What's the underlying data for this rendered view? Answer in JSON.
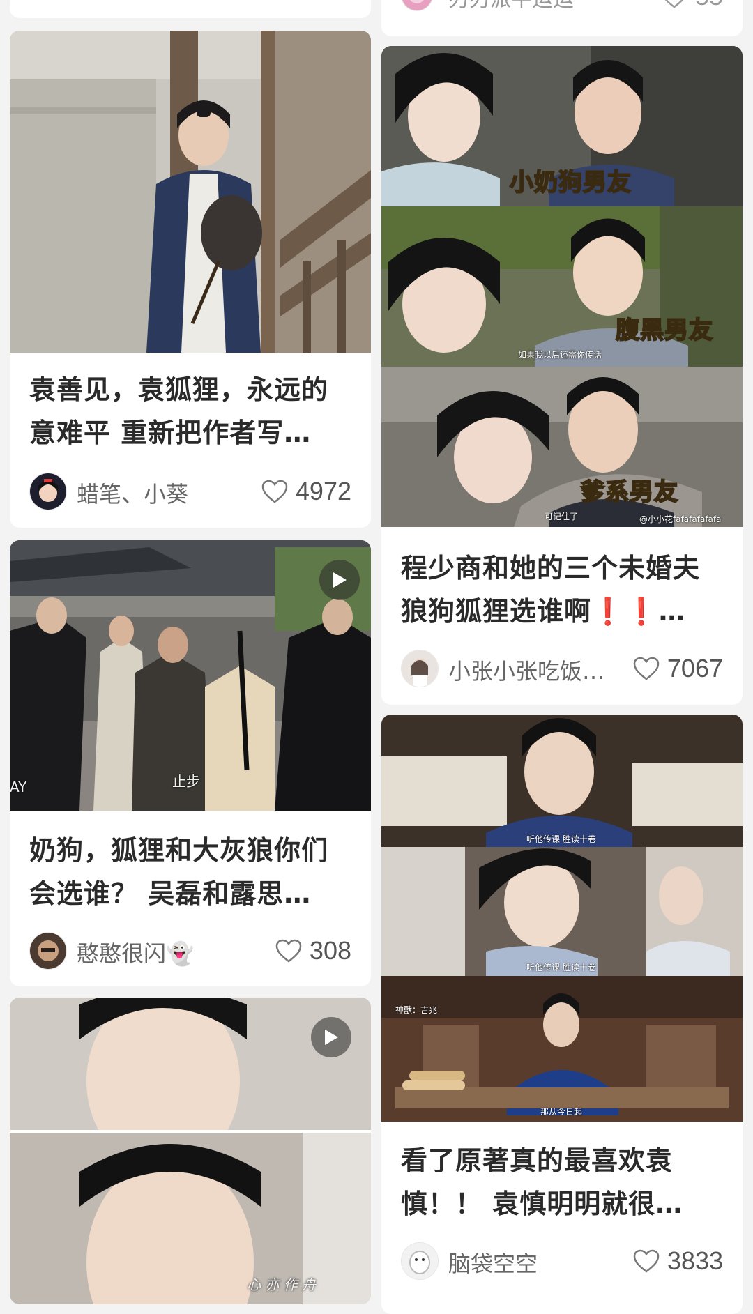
{
  "colors": {
    "background": "#f3f3f3",
    "card": "#ffffff",
    "caption": "#ffd84a",
    "heart": "#777777"
  },
  "feed": {
    "left": [
      {
        "title": "袁善见，袁狐狸，永远的意难平 重新把作者写…",
        "author": "蜡笔、小葵",
        "likes": "4972",
        "image_type": "photo"
      },
      {
        "title": "奶狗，狐狸和大灰狼你们会选谁？ 吴磊和露思…",
        "author": "憨憨很闪👻",
        "likes": "308",
        "image_type": "video",
        "overlay_left": "AY",
        "overlay_center": "止步"
      },
      {
        "image_type": "video",
        "overlay_bottom": "心 亦 作 舟"
      }
    ],
    "right": [
      {
        "author_partial": "刃刃派平运运",
        "likes_partial": "55"
      },
      {
        "title": "程少商和她的三个未婚夫 狼狗狐狸选谁啊❗️❗️…",
        "author": "小张小张吃饭…",
        "likes": "7067",
        "image_type": "collage",
        "panels": [
          {
            "caption": "小奶狗男友",
            "subtitle": ""
          },
          {
            "caption": "腹黑男友",
            "subtitle": "如果我以后还需你传话"
          },
          {
            "caption": "爹系男友",
            "subtitle": "可记住了",
            "watermark": "@小小花fafafafafafa"
          }
        ]
      },
      {
        "title": "看了原著真的最喜欢袁慎！！ 袁慎明明就很…",
        "author": "脑袋空空",
        "likes": "3833",
        "image_type": "collage",
        "panels": [
          {
            "subtitle": "听他传课 胜读十卷"
          },
          {
            "subtitle": "听他传课 胜读十卷"
          },
          {
            "subtitle": "那从今日起",
            "corner_text": "神獸：吉兆"
          }
        ]
      }
    ]
  }
}
